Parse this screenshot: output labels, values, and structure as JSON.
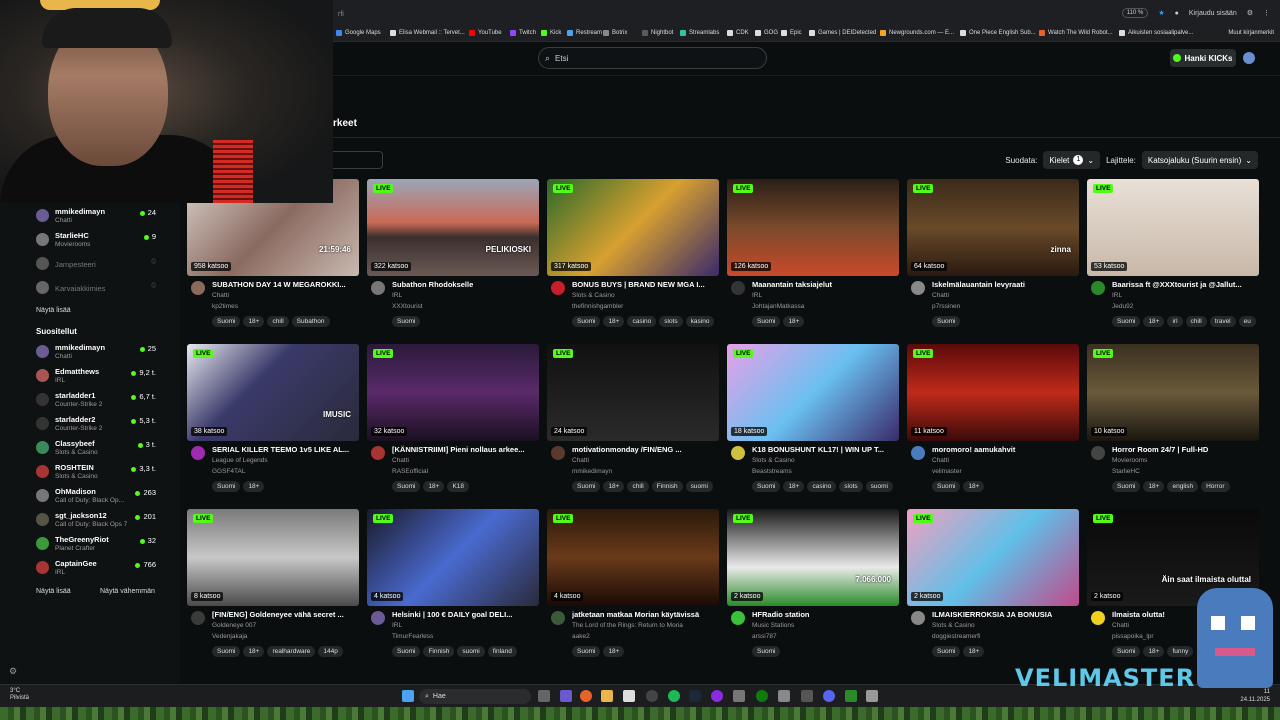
{
  "browser": {
    "url_fragment": "rfi",
    "zoom": "110 %",
    "login": "Kirjaudu sisään",
    "bookmarks": [
      "Google Maps",
      "Elisa Webmail :: Tervet...",
      "YouTube",
      "Twitch",
      "Kick",
      "Restream",
      "Botrix",
      "Nightbot",
      "Streamlabs",
      "CDK",
      "GOG",
      "Epic",
      "Games | DEIDetected",
      "Newgrounds.com — E...",
      "One Piece English Sub...",
      "Watch The Wild Robot...",
      "Aikuisten sosiaalipalve..."
    ],
    "other_bookmarks": "Muut kirjanmerkit"
  },
  "header": {
    "search_placeholder": "Etsi",
    "kicks_label": "Hanki KICKs"
  },
  "page": {
    "title": "rkeet"
  },
  "filters": {
    "filter_label": "Suodata:",
    "languages_label": "Kielet",
    "languages_count": "1",
    "sort_label": "Lajittele:",
    "sort_value": "Katsojaluku (Suurin ensin)"
  },
  "sidebar": {
    "following": [
      {
        "name": "mmikedimayn",
        "category": "Chatti",
        "viewers": "24",
        "online": true
      },
      {
        "name": "StarlieHC",
        "category": "Movierooms",
        "viewers": "9",
        "online": true
      },
      {
        "name": "Jampesteeri",
        "category": "",
        "viewers": "",
        "online": false
      },
      {
        "name": "Karvaiakkimies",
        "category": "",
        "viewers": "",
        "online": false
      }
    ],
    "show_more_following": "Näytä lisää",
    "recommended_heading": "Suositellut",
    "recommended": [
      {
        "name": "mmikedimayn",
        "category": "Chatti",
        "viewers": "25"
      },
      {
        "name": "Edmatthews",
        "category": "IRL",
        "viewers": "9,2 t."
      },
      {
        "name": "starladder1",
        "category": "Counter-Strike 2",
        "viewers": "6,7 t."
      },
      {
        "name": "starladder2",
        "category": "Counter-Strike 2",
        "viewers": "5,3 t."
      },
      {
        "name": "Classybeef",
        "category": "Slots & Casino",
        "viewers": "3 t."
      },
      {
        "name": "ROSHTEIN",
        "category": "Slots & Casino",
        "viewers": "3,3 t."
      },
      {
        "name": "OhMadison",
        "category": "Call of Duty: Black Op...",
        "viewers": "263"
      },
      {
        "name": "sgt_jackson12",
        "category": "Call of Duty: Black Ops 7",
        "viewers": "201"
      },
      {
        "name": "TheGreenyRiot",
        "category": "Planet Crafter",
        "viewers": "32"
      },
      {
        "name": "CaptainGee",
        "category": "IRL",
        "viewers": "766"
      }
    ],
    "show_more": "Näytä lisää",
    "show_less": "Näytä vähemmän"
  },
  "streams": [
    {
      "title": "SUBATHON DAY 14 W MEGAROKKI...",
      "category": "Chatti",
      "user": "kp2times",
      "viewers": "958 katsoo",
      "tags": [
        "Suomi",
        "18+",
        "chill",
        "Subathon"
      ],
      "overlay": "21:59:46"
    },
    {
      "title": "Subathon Rhodokselle",
      "category": "IRL",
      "user": "XXXtourist",
      "viewers": "322 katsoo",
      "tags": [
        "Suomi"
      ],
      "overlay": "PELIKIOSKI"
    },
    {
      "title": "BONUS BUYS | BRAND NEW MGA I...",
      "category": "Slots & Casino",
      "user": "thefinnishgambler",
      "viewers": "317 katsoo",
      "tags": [
        "Suomi",
        "18+",
        "casino",
        "slots",
        "kasino"
      ],
      "overlay": ""
    },
    {
      "title": "Maanantain taksiajelut",
      "category": "IRL",
      "user": "JohtajanMatkassa",
      "viewers": "126 katsoo",
      "tags": [
        "Suomi",
        "18+"
      ],
      "overlay": ""
    },
    {
      "title": "Iskelmälauantain levyraati",
      "category": "Chatti",
      "user": "p7rssinen",
      "viewers": "64 katsoo",
      "tags": [
        "Suomi"
      ],
      "overlay": "zinna"
    },
    {
      "title": "Baarissa ft @XXXtourist ja @Jallut...",
      "category": "IRL",
      "user": "Jedu92",
      "viewers": "53 katsoo",
      "tags": [
        "Suomi",
        "18+",
        "irl",
        "chill",
        "travel",
        "eu"
      ],
      "overlay": ""
    },
    {
      "title": "SERIAL KILLER TEEMO 1v5 LIKE AL...",
      "category": "League of Legends",
      "user": "GGSF4TAL",
      "viewers": "38 katsoo",
      "tags": [
        "Suomi",
        "18+"
      ],
      "overlay": "IMUSIC"
    },
    {
      "title": "[KÄNNISTRIIMI] Pieni nollaus arkee...",
      "category": "Chatti",
      "user": "RASEofficial",
      "viewers": "32 katsoo",
      "tags": [
        "Suomi",
        "18+",
        "K18"
      ],
      "overlay": ""
    },
    {
      "title": "motivationmonday /FIN/ENG ...",
      "category": "Chatti",
      "user": "mmikedimayn",
      "viewers": "24 katsoo",
      "tags": [
        "Suomi",
        "18+",
        "chill",
        "Finnish",
        "suomi"
      ],
      "overlay": ""
    },
    {
      "title": "K18 BONUSHUNT KL17! | WIN UP T...",
      "category": "Slots & Casino",
      "user": "Beaststreams",
      "viewers": "18 katsoo",
      "tags": [
        "Suomi",
        "18+",
        "casino",
        "slots",
        "suomi"
      ],
      "overlay": ""
    },
    {
      "title": "moromoro! aamukahvit",
      "category": "Chatti",
      "user": "velimaster",
      "viewers": "11 katsoo",
      "tags": [
        "Suomi",
        "18+"
      ],
      "overlay": ""
    },
    {
      "title": "Horror Room 24/7 | Full-HD",
      "category": "Movierooms",
      "user": "StarlieHC",
      "viewers": "10 katsoo",
      "tags": [
        "Suomi",
        "18+",
        "english",
        "Horror"
      ],
      "overlay": ""
    },
    {
      "title": "[FIN/ENG] Goldeneyee vähä secret ...",
      "category": "Goldeneye 007",
      "user": "Vedenjakaja",
      "viewers": "8 katsoo",
      "tags": [
        "Suomi",
        "18+",
        "realhardware",
        "144p"
      ],
      "overlay": ""
    },
    {
      "title": "Helsinki | 100 € DAILY goal DELI...",
      "category": "IRL",
      "user": "TimurFearless",
      "viewers": "4 katsoo",
      "tags": [
        "Suomi",
        "Finnish",
        "suomi",
        "finland"
      ],
      "overlay": ""
    },
    {
      "title": "jatketaan matkaa Morian käytävissä",
      "category": "The Lord of the Rings: Return to Moria",
      "user": "aake2",
      "viewers": "4 katsoo",
      "tags": [
        "Suomi",
        "18+"
      ],
      "overlay": ""
    },
    {
      "title": "HFRadio station",
      "category": "Music Stations",
      "user": "arssi787",
      "viewers": "2 katsoo",
      "tags": [
        "Suomi"
      ],
      "overlay": "7.066.000"
    },
    {
      "title": "ILMAISKIERROKSIA JA BONUSIA",
      "category": "Slots & Casino",
      "user": "doggiestreamerfi",
      "viewers": "2 katsoo",
      "tags": [
        "Suomi",
        "18+"
      ],
      "overlay": ""
    },
    {
      "title": "Ilmaista olutta!",
      "category": "Chatti",
      "user": "pissapoika_lpr",
      "viewers": "2 katsoo",
      "tags": [
        "Suomi",
        "18+",
        "funny"
      ],
      "overlay": "Äin saat ilmaista oluttaI"
    }
  ],
  "live_label": "LIVE",
  "taskbar": {
    "temp": "3°C",
    "weather": "Pilvistä",
    "search": "Hae",
    "time": "11",
    "date": "24.11.2025"
  },
  "overlay_brand": "VELIMASTER",
  "colors": {
    "accent": "#53fc18",
    "bg": "#0b0e0f"
  }
}
